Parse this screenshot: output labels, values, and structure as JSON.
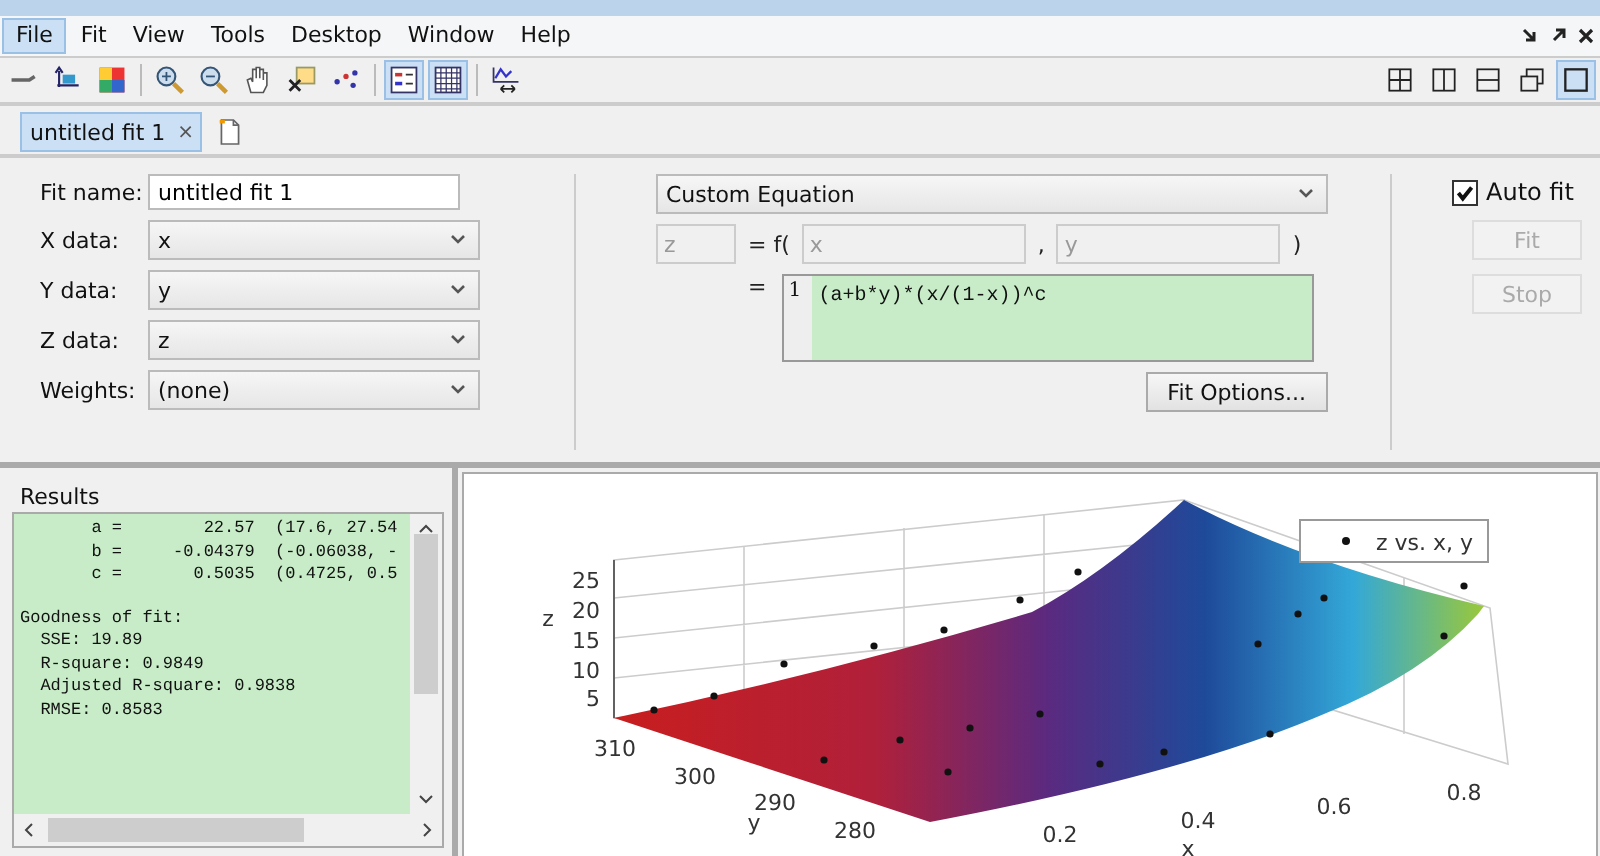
{
  "menu": [
    {
      "label": "File",
      "selected": true
    },
    {
      "label": "Fit",
      "selected": false
    },
    {
      "label": "View",
      "selected": false
    },
    {
      "label": "Tools",
      "selected": false
    },
    {
      "label": "Desktop",
      "selected": false
    },
    {
      "label": "Window",
      "selected": false
    },
    {
      "label": "Help",
      "selected": false
    }
  ],
  "toolbar": [
    {
      "kind": "arrow",
      "selected": false
    },
    {
      "kind": "axes",
      "selected": false
    },
    {
      "kind": "colormap",
      "selected": false
    },
    {
      "kind": "sep"
    },
    {
      "kind": "zoom-in",
      "selected": false
    },
    {
      "kind": "zoom-out",
      "selected": false
    },
    {
      "kind": "pan",
      "selected": false
    },
    {
      "kind": "cursor",
      "selected": false
    },
    {
      "kind": "exclude",
      "selected": false
    },
    {
      "kind": "sep"
    },
    {
      "kind": "legend",
      "selected": true
    },
    {
      "kind": "grid",
      "selected": true
    },
    {
      "kind": "sep"
    },
    {
      "kind": "residuals",
      "selected": false
    }
  ],
  "layouts": [
    {
      "kind": "quad",
      "selected": false
    },
    {
      "kind": "cols",
      "selected": false
    },
    {
      "kind": "rows",
      "selected": false
    },
    {
      "kind": "restore",
      "selected": false
    },
    {
      "kind": "single",
      "selected": true
    }
  ],
  "tabs": [
    {
      "label": "untitled fit 1",
      "close": "×",
      "selected": true
    }
  ],
  "fit_form": [
    {
      "kind": "text",
      "label": "Fit name:",
      "value": "untitled fit 1"
    },
    {
      "kind": "select",
      "label": "X data:",
      "value": "x"
    },
    {
      "kind": "select",
      "label": "Y data:",
      "value": "y"
    },
    {
      "kind": "select",
      "label": "Z data:",
      "value": "z"
    },
    {
      "kind": "select",
      "label": "Weights:",
      "value": "(none)"
    }
  ],
  "equation": {
    "type": "Custom Equation",
    "output": "z",
    "equals_f": "= f(",
    "input_1": "x",
    "comma": ",",
    "input_2": "y",
    "close": ")",
    "equals": "=",
    "line_number": "1",
    "expression": "(a+b*y)*(x/(1-x))^c",
    "options_button": "Fit Options..."
  },
  "fit_controls": {
    "auto_fit": {
      "label": "Auto fit",
      "checked": true
    },
    "buttons": [
      {
        "label": "Fit",
        "disabled": true
      },
      {
        "label": "Stop",
        "disabled": true
      }
    ]
  },
  "results": {
    "title": "Results",
    "coefficients": [
      "       a =        22.57  (17.6, 27.54",
      "       b =     -0.04379  (-0.06038, -",
      "       c =       0.5035  (0.4725, 0.5"
    ],
    "goodness": [
      "Goodness of fit:",
      "  SSE: 19.89",
      "  R-square: 0.9849",
      "  Adjusted R-square: 0.9838",
      "  RMSE: 0.8583"
    ]
  },
  "plot": {
    "legend": "z vs. x, y",
    "zlabel": "z",
    "ylabel": "y",
    "xlabel": "x",
    "zticks": [
      "25",
      "20",
      "15",
      "10",
      "5"
    ],
    "yticks": [
      "310",
      "300",
      "290",
      "280"
    ],
    "xticks": [
      "0.2",
      "0.4",
      "0.6",
      "0.8"
    ]
  }
}
